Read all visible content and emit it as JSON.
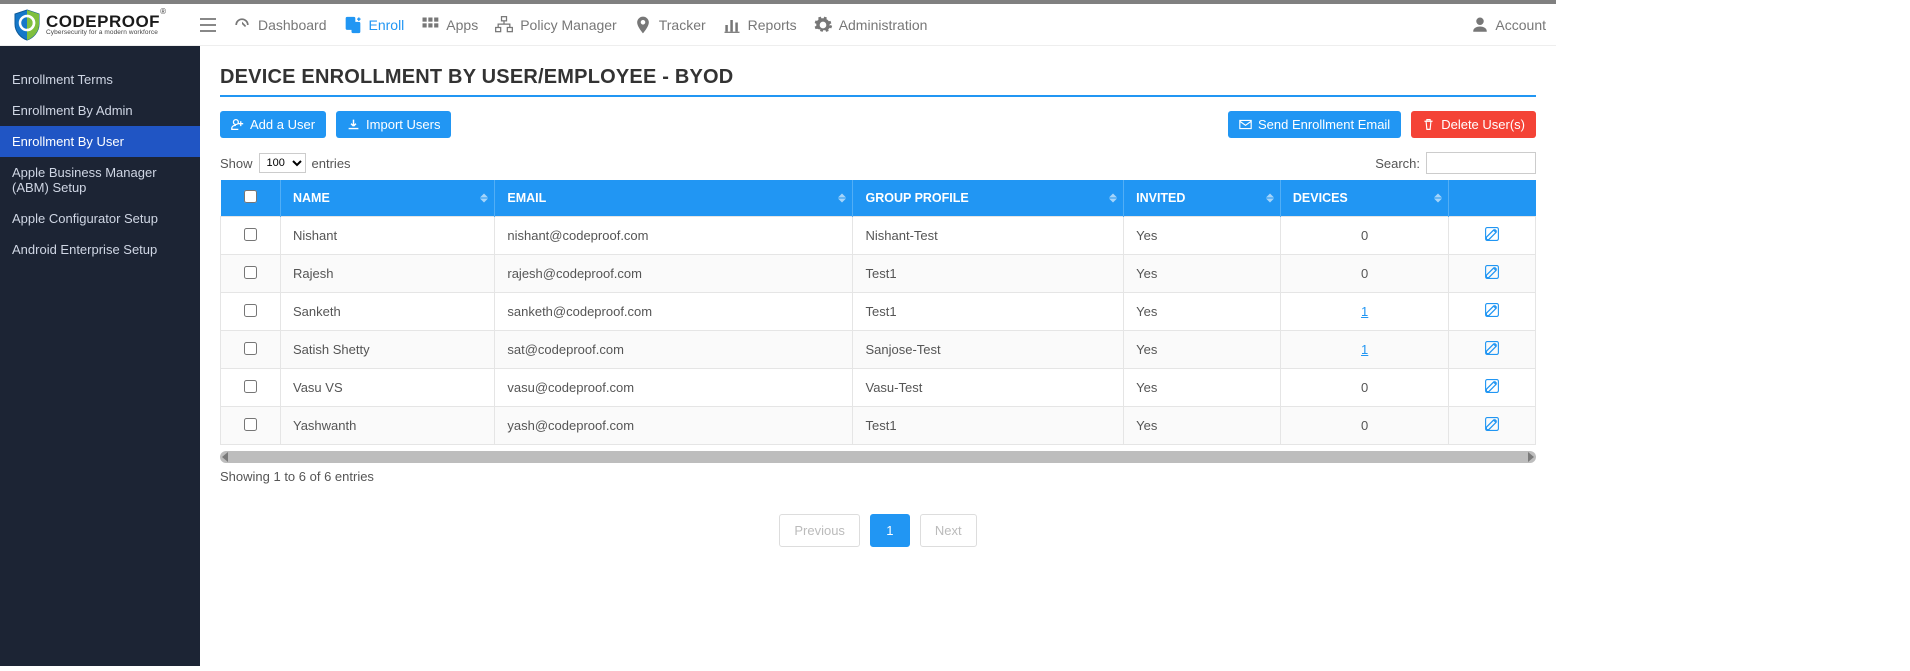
{
  "brand": {
    "name": "CODEPROOF",
    "tagline": "Cybersecurity for a modern workforce",
    "tm": "®"
  },
  "topnav": {
    "dashboard": "Dashboard",
    "enroll": "Enroll",
    "apps": "Apps",
    "policy": "Policy Manager",
    "tracker": "Tracker",
    "reports": "Reports",
    "admin": "Administration",
    "account": "Account"
  },
  "sidebar": {
    "items": [
      {
        "label": "Enrollment Terms"
      },
      {
        "label": "Enrollment By Admin"
      },
      {
        "label": "Enrollment By User"
      },
      {
        "label": "Apple Business Manager (ABM) Setup"
      },
      {
        "label": "Apple Configurator Setup"
      },
      {
        "label": "Android Enterprise Setup"
      }
    ],
    "active_index": 2
  },
  "page": {
    "title": "DEVICE ENROLLMENT BY USER/EMPLOYEE - BYOD"
  },
  "toolbar": {
    "add_user": "Add a User",
    "import_users": "Import Users",
    "send_email": "Send Enrollment Email",
    "delete_users": "Delete User(s)"
  },
  "datatable": {
    "show_label_pre": "Show",
    "show_label_post": "entries",
    "page_length": "100",
    "search_label": "Search:",
    "search_value": "",
    "columns": {
      "name": "Name",
      "email": "Email",
      "group": "Group Profile",
      "invited": "Invited",
      "devices": "Devices"
    },
    "rows": [
      {
        "name": "Nishant",
        "email": "nishant@codeproof.com",
        "group": "Nishant-Test",
        "invited": "Yes",
        "devices": 0,
        "devices_link": false
      },
      {
        "name": "Rajesh",
        "email": "rajesh@codeproof.com",
        "group": "Test1",
        "invited": "Yes",
        "devices": 0,
        "devices_link": false
      },
      {
        "name": "Sanketh",
        "email": "sanketh@codeproof.com",
        "group": "Test1",
        "invited": "Yes",
        "devices": 1,
        "devices_link": true
      },
      {
        "name": "Satish Shetty",
        "email": "sat@codeproof.com",
        "group": "Sanjose-Test",
        "invited": "Yes",
        "devices": 1,
        "devices_link": true
      },
      {
        "name": "Vasu VS",
        "email": "vasu@codeproof.com",
        "group": "Vasu-Test",
        "invited": "Yes",
        "devices": 0,
        "devices_link": false
      },
      {
        "name": "Yashwanth",
        "email": "yash@codeproof.com",
        "group": "Test1",
        "invited": "Yes",
        "devices": 0,
        "devices_link": false
      }
    ],
    "info": "Showing 1 to 6 of 6 entries",
    "pager": {
      "prev": "Previous",
      "current": "1",
      "next": "Next"
    }
  }
}
